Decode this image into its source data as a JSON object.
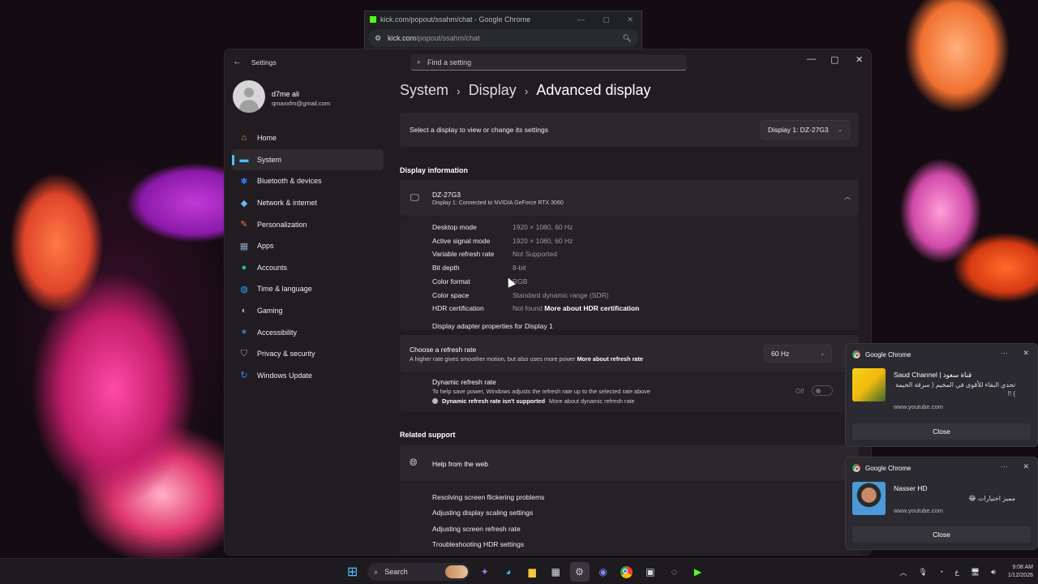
{
  "chrome_popout": {
    "title": "kick.com/popout/ssahm/chat - Google Chrome",
    "url_host": "kick.com",
    "url_path": "/popout/ssahm/chat"
  },
  "settings": {
    "app_title": "Settings",
    "search_placeholder": "Find a setting",
    "profile": {
      "name": "d7me ali",
      "email": "qmaxxfm@gmail.com"
    },
    "nav": [
      {
        "label": "Home",
        "icon": "home-icon",
        "color": "#f2a33a"
      },
      {
        "label": "System",
        "icon": "monitor-icon",
        "color": "#4cc2ff"
      },
      {
        "label": "Bluetooth & devices",
        "icon": "bluetooth-icon",
        "color": "#2f7bf0"
      },
      {
        "label": "Network & internet",
        "icon": "wifi-icon",
        "color": "#63b8f4"
      },
      {
        "label": "Personalization",
        "icon": "brush-icon",
        "color": "#f07b4a"
      },
      {
        "label": "Apps",
        "icon": "apps-icon",
        "color": "#8fa2c4"
      },
      {
        "label": "Accounts",
        "icon": "person-icon",
        "color": "#2fc27a"
      },
      {
        "label": "Time & language",
        "icon": "globe-clock-icon",
        "color": "#2aa6e8"
      },
      {
        "label": "Gaming",
        "icon": "gamepad-icon",
        "color": "#a8a8a8"
      },
      {
        "label": "Accessibility",
        "icon": "accessibility-icon",
        "color": "#3d8de8"
      },
      {
        "label": "Privacy & security",
        "icon": "shield-icon",
        "color": "#9aa0a8"
      },
      {
        "label": "Windows Update",
        "icon": "update-icon",
        "color": "#2f8fe8"
      }
    ],
    "breadcrumb": {
      "level1": "System",
      "level2": "Display",
      "current": "Advanced display"
    },
    "select_display": {
      "label": "Select a display to view or change its settings",
      "value": "Display 1: DZ-27G3"
    },
    "display_info": {
      "heading": "Display information",
      "name": "DZ-27G3",
      "subtitle": "Display 1: Connected to NVIDIA GeForce RTX 3060",
      "rows": [
        {
          "label": "Desktop mode",
          "value": "1920 × 1080, 60 Hz"
        },
        {
          "label": "Active signal mode",
          "value": "1920 × 1080, 60 Hz"
        },
        {
          "label": "Variable refresh rate",
          "value": "Not Supported"
        },
        {
          "label": "Bit depth",
          "value": "8-bit"
        },
        {
          "label": "Color format",
          "value": "RGB"
        },
        {
          "label": "Color space",
          "value": "Standard dynamic range (SDR)"
        },
        {
          "label": "HDR certification",
          "value": "Not found",
          "link": "More about HDR certification"
        }
      ],
      "adapter_link": "Display adapter properties for Display 1"
    },
    "refresh": {
      "title": "Choose a refresh rate",
      "subtitle": "A higher rate gives smoother motion, but also uses more power",
      "link": "More about refresh rate",
      "value": "60 Hz"
    },
    "dynamic_refresh": {
      "title": "Dynamic refresh rate",
      "subtitle": "To help save power, Windows adjusts the refresh rate up to the selected rate above",
      "note_bold": "Dynamic refresh rate isn't supported",
      "note_link": "More about dynamic refresh rate",
      "state": "Off"
    },
    "related": {
      "heading": "Related support",
      "help_title": "Help from the web",
      "links": [
        "Resolving screen flickering problems",
        "Adjusting display scaling settings",
        "Adjusting screen refresh rate",
        "Troubleshooting HDR settings"
      ]
    }
  },
  "notifications": [
    {
      "app": "Google Chrome",
      "title": "Saud Channel | قناة سعود",
      "message": "تحدي البقاء للأقوى في المخيم ( سرقة الخيمة ) !!",
      "source": "www.youtube.com",
      "button": "Close"
    },
    {
      "app": "Google Chrome",
      "title": "Nasser HD",
      "message": "مميز اختيارات 😂",
      "source": "www.youtube.com",
      "button": "Close"
    }
  ],
  "taskbar": {
    "search_label": "Search",
    "time": "9:08 AM",
    "date": "1/12/2026",
    "lang": "ع"
  }
}
